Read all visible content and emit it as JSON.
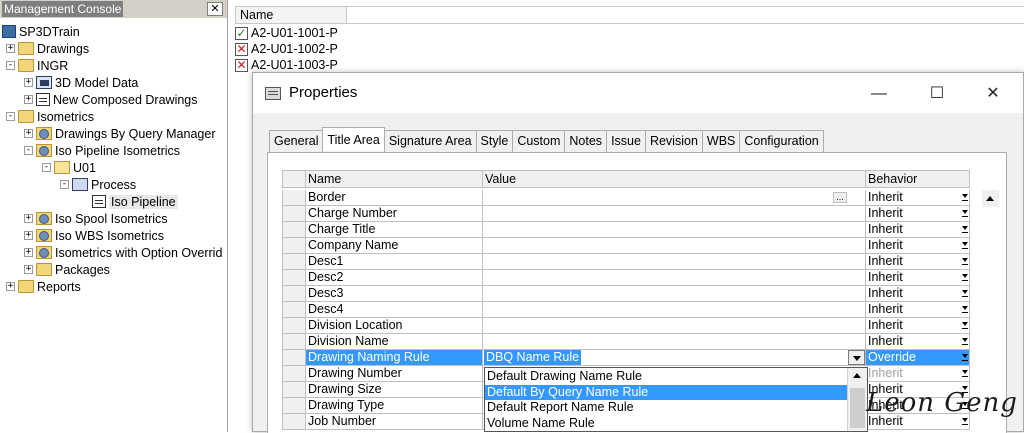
{
  "left_pane": {
    "title": "Management Console",
    "close_glyph": "✕",
    "tree": [
      {
        "label": "SP3DTrain",
        "icon": "train-icon"
      },
      {
        "label": "Drawings",
        "icon": "folder-icon",
        "expander": "+"
      },
      {
        "label": "INGR",
        "icon": "folder-icon",
        "expander": "-"
      },
      {
        "label": "3D Model Data",
        "icon": "database-icon",
        "expander": "+"
      },
      {
        "label": "New Composed Drawings",
        "icon": "document-icon",
        "expander": "+"
      },
      {
        "label": "Isometrics",
        "icon": "folder-icon",
        "expander": "-"
      },
      {
        "label": "Drawings By Query Manager",
        "icon": "gear-folder-icon",
        "expander": "+"
      },
      {
        "label": "Iso Pipeline Isometrics",
        "icon": "gear-folder-icon",
        "expander": "-"
      },
      {
        "label": "U01",
        "icon": "open-folder-icon",
        "expander": "-"
      },
      {
        "label": "Process",
        "icon": "process-icon",
        "expander": "-"
      },
      {
        "label": "Iso Pipeline",
        "icon": "iso-icon"
      },
      {
        "label": "Iso Spool Isometrics",
        "icon": "gear-folder-icon",
        "expander": "+"
      },
      {
        "label": "Iso WBS Isometrics",
        "icon": "gear-folder-icon",
        "expander": "+"
      },
      {
        "label": "Isometrics with Option Overrid",
        "icon": "gear-folder-icon",
        "expander": "+"
      },
      {
        "label": "Packages",
        "icon": "folder-icon",
        "expander": "+"
      },
      {
        "label": "Reports",
        "icon": "folder-icon",
        "expander": "+"
      }
    ]
  },
  "list": {
    "header": "Name",
    "rows": [
      {
        "label": "A2-U01-1001-P",
        "status": "check"
      },
      {
        "label": "A2-U01-1002-P",
        "status": "x"
      },
      {
        "label": "A2-U01-1003-P",
        "status": "x"
      }
    ]
  },
  "dialog": {
    "title": "Properties",
    "minimize": "—",
    "maximize": "☐",
    "close": "✕",
    "tabs": [
      "General",
      "Title Area",
      "Signature Area",
      "Style",
      "Custom",
      "Notes",
      "Issue",
      "Revision",
      "WBS",
      "Configuration"
    ],
    "active_tab": "Title Area",
    "grid": {
      "headers": {
        "name": "Name",
        "value": "Value",
        "behavior": "Behavior"
      },
      "rows": [
        {
          "name": "Border",
          "value": "",
          "behavior": "Inherit",
          "ellipsis": "..."
        },
        {
          "name": "Charge Number",
          "value": "",
          "behavior": "Inherit"
        },
        {
          "name": "Charge Title",
          "value": "",
          "behavior": "Inherit"
        },
        {
          "name": "Company Name",
          "value": "",
          "behavior": "Inherit"
        },
        {
          "name": "Desc1",
          "value": "",
          "behavior": "Inherit"
        },
        {
          "name": "Desc2",
          "value": "",
          "behavior": "Inherit"
        },
        {
          "name": "Desc3",
          "value": "",
          "behavior": "Inherit"
        },
        {
          "name": "Desc4",
          "value": "",
          "behavior": "Inherit"
        },
        {
          "name": "Division Location",
          "value": "",
          "behavior": "Inherit"
        },
        {
          "name": "Division Name",
          "value": "",
          "behavior": "Inherit"
        },
        {
          "name": "Drawing Naming Rule",
          "value": "DBQ Name Rule",
          "behavior": "Override",
          "selected": true
        },
        {
          "name": "Drawing Number",
          "value": "",
          "behavior": "Inherit",
          "dim": true
        },
        {
          "name": "Drawing Size",
          "value": "",
          "behavior": "Inherit"
        },
        {
          "name": "Drawing Type",
          "value": "",
          "behavior": "Inherit"
        },
        {
          "name": "Job Number",
          "value": "",
          "behavior": "Inherit"
        }
      ]
    },
    "dropdown_options": [
      {
        "label": "Default Drawing Name Rule",
        "highlighted": false
      },
      {
        "label": "Default By Query Name Rule",
        "highlighted": true
      },
      {
        "label": "Default Report Name Rule",
        "highlighted": false
      },
      {
        "label": "Volume Name Rule",
        "highlighted": false
      }
    ]
  },
  "watermark": "Leon Geng"
}
